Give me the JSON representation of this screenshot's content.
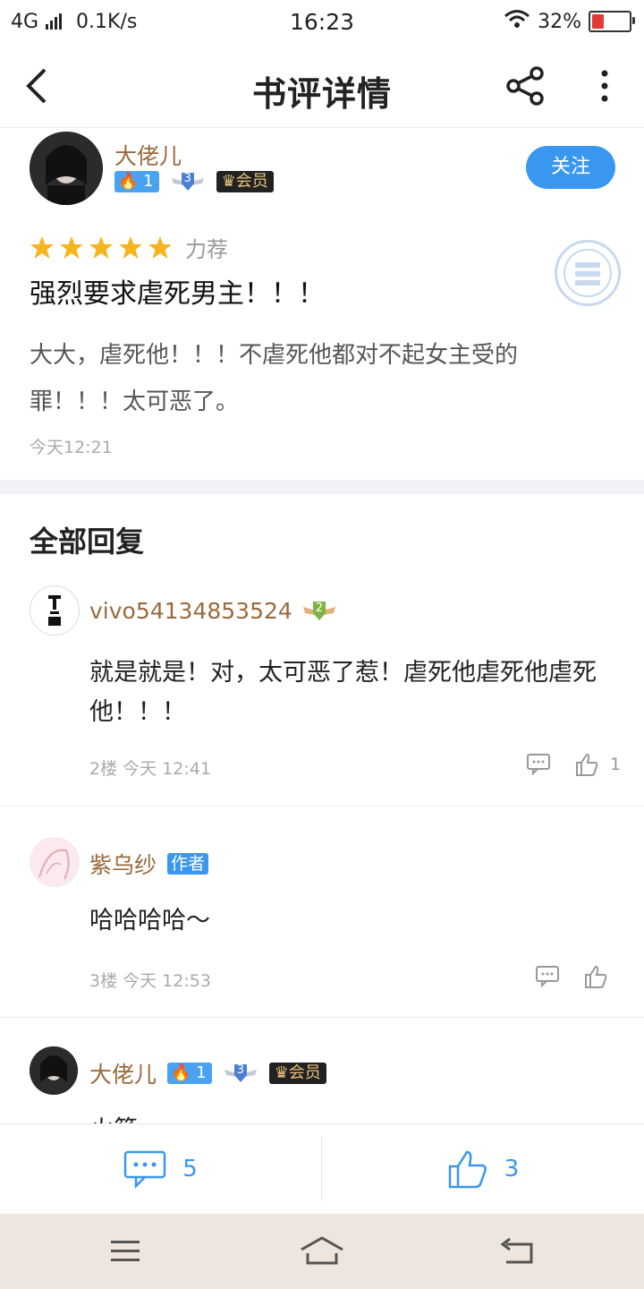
{
  "status": {
    "network": "4G",
    "speed": "0.1K/s",
    "time": "16:23",
    "battery": "32%",
    "battery_level": 0.32
  },
  "header": {
    "title": "书评详情"
  },
  "review": {
    "user": {
      "name": "大佬儿",
      "fire_level": "1",
      "badge_level": "3",
      "vip": "会员"
    },
    "follow_label": "关注",
    "rating": 5,
    "rating_label": "力荐",
    "title": "强烈要求虐死男主！！！",
    "body": "大大，虐死他！！！不虐死他都对不起女主受的罪！！！太可恶了。",
    "time": "今天12:21"
  },
  "replies_title": "全部回复",
  "replies": [
    {
      "name": "vivo54134853524",
      "badge_level": "2",
      "text": "就是就是！对，太可恶了惹！虐死他虐死他虐死他！！！",
      "meta": "2楼 今天 12:41",
      "likes": "1"
    },
    {
      "name": "紫乌纱",
      "author_tag": "作者",
      "text": "哈哈哈哈～",
      "meta": "3楼 今天 12:53",
      "likes": ""
    },
    {
      "name": "大佬儿",
      "fire_level": "1",
      "badge_level": "3",
      "vip": "会员",
      "text": "火箭"
    }
  ],
  "bottom": {
    "comments": "5",
    "likes": "3"
  },
  "colors": {
    "accent": "#3a97f0",
    "username": "#9a6a3e",
    "star": "#f6b51e"
  }
}
